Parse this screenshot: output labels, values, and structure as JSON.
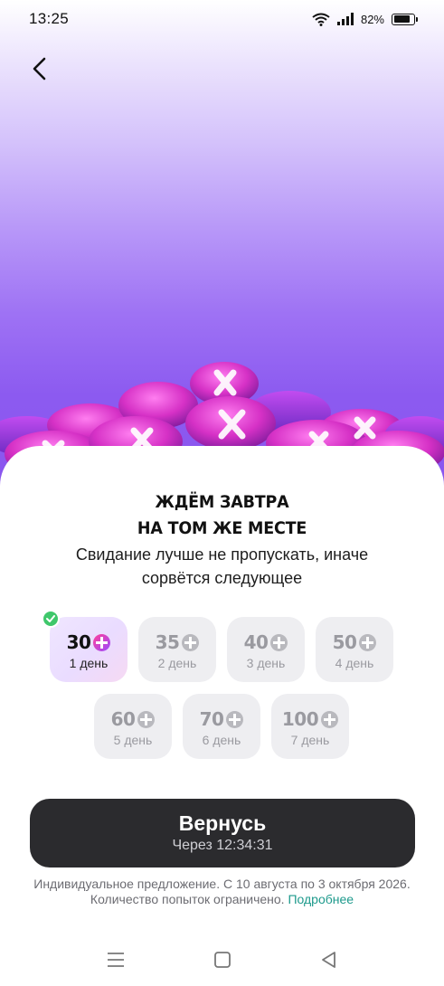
{
  "status_bar": {
    "time": "13:25",
    "battery_text": "82%",
    "battery_level": 0.82,
    "icons": [
      "wifi-icon",
      "signal-icon",
      "battery-icon"
    ]
  },
  "header": {
    "back_icon": "chevron-left-icon"
  },
  "offer": {
    "title_line1": "ЖДЁМ ЗАВТРА",
    "title_line2": "НА ТОМ ЖЕ МЕСТЕ",
    "subtitle": "Свидание лучше не пропускать, иначе сорвётся следующее"
  },
  "days": [
    {
      "value": "30",
      "label": "1 день",
      "active": true,
      "completed": true
    },
    {
      "value": "35",
      "label": "2 день",
      "active": false,
      "completed": false
    },
    {
      "value": "40",
      "label": "3 день",
      "active": false,
      "completed": false
    },
    {
      "value": "50",
      "label": "4 день",
      "active": false,
      "completed": false
    },
    {
      "value": "60",
      "label": "5 день",
      "active": false,
      "completed": false
    },
    {
      "value": "70",
      "label": "6 день",
      "active": false,
      "completed": false
    },
    {
      "value": "100",
      "label": "7 день",
      "active": false,
      "completed": false
    }
  ],
  "cta": {
    "label": "Вернусь",
    "timer_text": "Через 12:34:31"
  },
  "footnote": {
    "line1": "Индивидуальное предложение. С 10 августа по 3 октября 2026.",
    "line2": "Количество попыток ограничено.",
    "link": "Подробнее"
  },
  "colors": {
    "accent_purple": "#8a55ee",
    "coin_pink": "#e23ad2",
    "cta_background": "#2b2b2e",
    "link": "#1e9a8c",
    "check_green": "#3fc76b"
  },
  "nav_bar": {
    "icons": [
      "menu-icon",
      "home-square-icon",
      "back-triangle-icon"
    ]
  }
}
